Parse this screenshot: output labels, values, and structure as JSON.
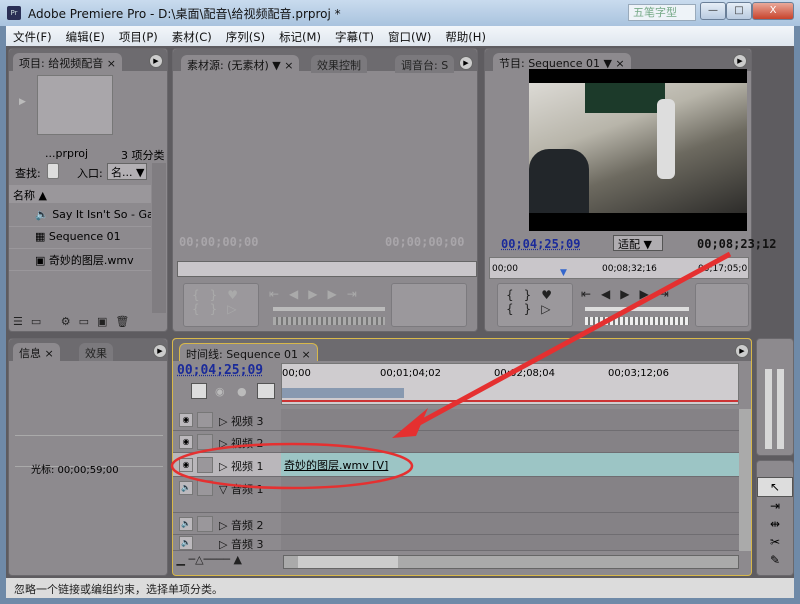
{
  "window": {
    "title": "Adobe Premiere Pro - D:\\桌面\\配音\\给视频配音.prproj *",
    "app_icon": "Pr",
    "watermark": "五笔字型",
    "buttons": {
      "minimize": "—",
      "maximize": "□",
      "close": "X"
    }
  },
  "menu": [
    "文件(F)",
    "编辑(E)",
    "项目(P)",
    "素材(C)",
    "序列(S)",
    "标记(M)",
    "字幕(T)",
    "窗口(W)",
    "帮助(H)"
  ],
  "project": {
    "tab": "项目: 给视频配音",
    "project_name": "...prproj",
    "count": "3 项分类",
    "find_label": "查找:",
    "in_label": "入口:",
    "in_value": "名...",
    "column_name": "名称",
    "items": [
      {
        "icon": "audio-icon",
        "name": "Say It Isn't So - Gare"
      },
      {
        "icon": "sequence-icon",
        "name": "Sequence 01"
      },
      {
        "icon": "video-file-icon",
        "name": "奇妙的图层.wmv"
      }
    ]
  },
  "source": {
    "tabs": [
      "素材源: (无素材)",
      "效果控制",
      "调音台: S"
    ],
    "tc_in": "00;00;00;00",
    "tc_out": "00;00;00;00"
  },
  "program": {
    "tab": "节目: Sequence 01",
    "tc_current": "00;04;25;09",
    "fit": "适配",
    "tc_duration": "00;08;23;12",
    "ruler": [
      "00;00",
      "00;08;32;16",
      "00;17;05;0"
    ]
  },
  "info": {
    "tabs": [
      "信息",
      "效果"
    ],
    "cursor": "光标: 00;00;59;00"
  },
  "timeline": {
    "tab": "时间线: Sequence 01",
    "tc": "00;04;25;09",
    "ruler": [
      "00;00",
      "00;01;04;02",
      "00;02;08;04",
      "00;03;12;06"
    ],
    "tracks": [
      {
        "name": "视频 3",
        "type": "video"
      },
      {
        "name": "视频 2",
        "type": "video"
      },
      {
        "name": "视频 1",
        "type": "video",
        "clip": "奇妙的图层.wmv [V]"
      },
      {
        "name": "音频 1",
        "type": "audio"
      },
      {
        "name": "音频 2",
        "type": "audio"
      },
      {
        "name": "音频 3",
        "type": "audio"
      }
    ]
  },
  "status": "忽略一个链接或编组约束，选择单项分类。",
  "colors": {
    "timecode": "#1a2a9a",
    "clip": "#9cc5c5",
    "annotation": "#e53030"
  }
}
